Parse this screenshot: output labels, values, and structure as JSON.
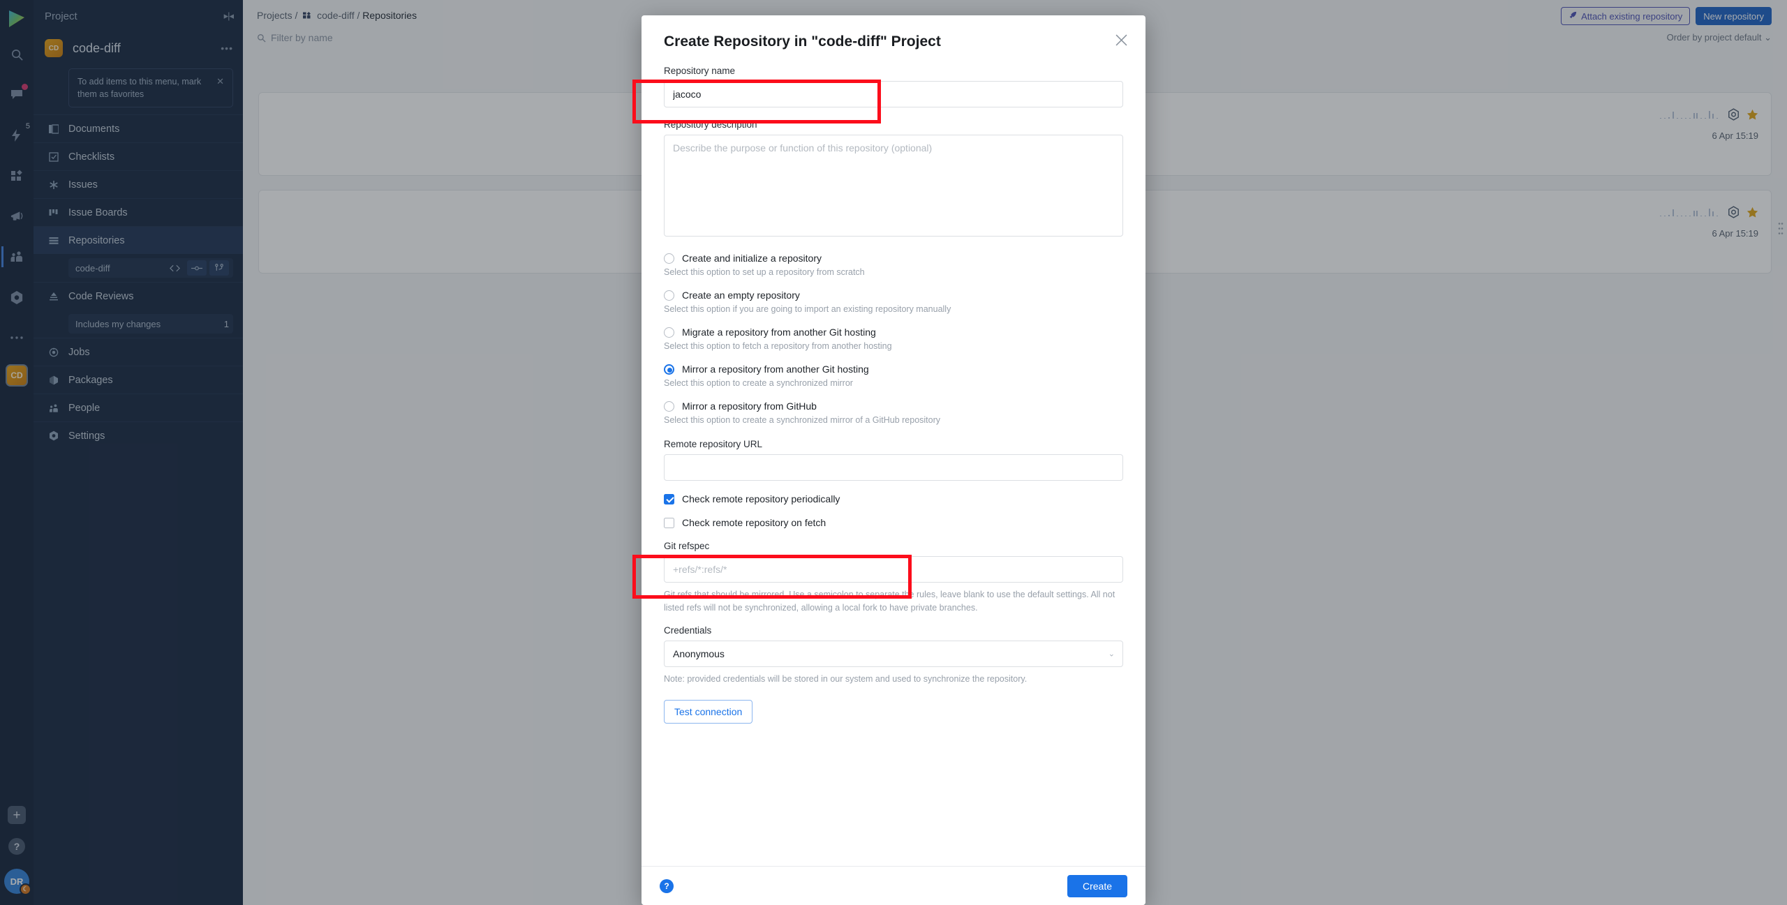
{
  "rail": {
    "logo_icon": "app-logo-icon",
    "items": [
      {
        "icon": "search-icon",
        "name": "search"
      },
      {
        "icon": "chat-bubble-icon",
        "name": "chats",
        "badge_dot": true
      },
      {
        "icon": "lightning-icon",
        "name": "todo",
        "badge": "5"
      },
      {
        "icon": "apps-grid-icon",
        "name": "apps"
      },
      {
        "icon": "megaphone-icon",
        "name": "blog"
      },
      {
        "icon": "people-icon",
        "name": "teams"
      },
      {
        "icon": "hexagon-icon",
        "name": "extensions"
      },
      {
        "icon": "ellipsis-icon",
        "name": "more"
      }
    ],
    "project_chip": "CD",
    "plus_label": "+",
    "help_label": "?",
    "avatar_initials": "DR"
  },
  "sidebar": {
    "header": "Project",
    "project_name": "code-diff",
    "project_initials": "CD",
    "more_label": "•••",
    "hint": "To add items to this menu, mark them as favorites",
    "items": [
      {
        "label": "Documents",
        "icon": "documents-icon"
      },
      {
        "label": "Checklists",
        "icon": "checklist-icon"
      },
      {
        "label": "Issues",
        "icon": "issues-icon"
      },
      {
        "label": "Issue Boards",
        "icon": "board-icon"
      },
      {
        "label": "Repositories",
        "icon": "repositories-icon",
        "active": true
      },
      {
        "label": "Code Reviews",
        "icon": "code-review-icon"
      },
      {
        "label": "Jobs",
        "icon": "jobs-icon"
      },
      {
        "label": "Packages",
        "icon": "packages-icon"
      },
      {
        "label": "People",
        "icon": "people-icon"
      },
      {
        "label": "Settings",
        "icon": "settings-icon"
      }
    ],
    "repo_sub": {
      "label": "code-diff",
      "code_icon": "code-brackets-icon",
      "commit_icon": "commit-icon",
      "branch_icon": "branch-icon"
    },
    "review_sub": {
      "label": "Includes my changes",
      "count": "1"
    }
  },
  "header": {
    "breadcrumb": {
      "root": "Projects",
      "project": "code-diff",
      "current": "Repositories",
      "sep": "/"
    },
    "filter_placeholder": "Filter by name",
    "attach_button": "Attach existing repository",
    "new_button": "New repository",
    "order_by": "Order by project default"
  },
  "cards": [
    {
      "date": "6 Apr 15:19",
      "gear_icon": "gear-icon",
      "star_icon": "star-icon"
    },
    {
      "date": "6 Apr 15:19",
      "gear_icon": "gear-icon",
      "star_icon": "star-icon"
    }
  ],
  "modal": {
    "title": "Create Repository in \"code-diff\" Project",
    "close_icon": "close-icon",
    "name_label": "Repository name",
    "name_value": "jacoco",
    "desc_label": "Repository description",
    "desc_placeholder": "Describe the purpose or function of this repository (optional)",
    "options": [
      {
        "label": "Create and initialize a repository",
        "help": "Select this option to set up a repository from scratch",
        "selected": false
      },
      {
        "label": "Create an empty repository",
        "help": "Select this option if you are going to import an existing repository manually",
        "selected": false
      },
      {
        "label": "Migrate a repository from another Git hosting",
        "help": "Select this option to fetch a repository from another hosting",
        "selected": false
      },
      {
        "label": "Mirror a repository from another Git hosting",
        "help": "Select this option to create a synchronized mirror",
        "selected": true
      },
      {
        "label": "Mirror a repository from GitHub",
        "help": "Select this option to create a synchronized mirror of a GitHub repository",
        "selected": false
      }
    ],
    "url_label": "Remote repository URL",
    "url_value": "",
    "url_placeholder": "",
    "check_periodically": {
      "label": "Check remote repository periodically",
      "checked": true
    },
    "check_on_fetch": {
      "label": "Check remote repository on fetch",
      "checked": false
    },
    "refspec_label": "Git refspec",
    "refspec_placeholder": "+refs/*:refs/*",
    "refspec_help": "Git refs that should be mirrored. Use a semicolon to separate the rules, leave blank to use the default settings. All not listed refs will not be synchronized, allowing a local fork to have private branches.",
    "credentials_label": "Credentials",
    "credentials_value": "Anonymous",
    "credentials_note": "Note: provided credentials will be stored in our system and used to synchronize the repository.",
    "test_button": "Test connection",
    "footer_help": "?",
    "create_button": "Create"
  },
  "colors": {
    "accent_blue": "#1a73e8",
    "sidebar_bg": "#15263f",
    "rail_bg": "#112137",
    "annotation_red": "#fc0d1b",
    "star_gold": "#e0a313"
  }
}
